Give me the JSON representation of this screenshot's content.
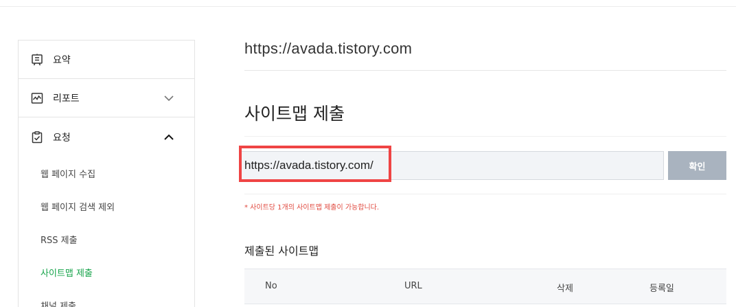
{
  "sidebar": {
    "items": [
      {
        "label": "요약",
        "icon": "summary-icon"
      },
      {
        "label": "리포트",
        "icon": "report-icon",
        "chevron": "chevron-down"
      },
      {
        "label": "요청",
        "icon": "request-icon",
        "chevron": "chevron-up"
      }
    ],
    "sub_items": [
      {
        "label": "웹 페이지 수집",
        "active": false
      },
      {
        "label": "웹 페이지 검색 제외",
        "active": false
      },
      {
        "label": "RSS 제출",
        "active": false
      },
      {
        "label": "사이트맵 제출",
        "active": true
      },
      {
        "label": "채널 제출",
        "active": false
      }
    ]
  },
  "main": {
    "site_url": "https://avada.tistory.com",
    "heading": "사이트맵 제출",
    "sitemap_input_value": "https://avada.tistory.com/",
    "confirm_label": "확인",
    "notice": "* 사이트당 1개의 사이트맵 제출이 가능합니다.",
    "submitted_heading": "제출된 사이트맵",
    "table_headers": [
      "No",
      "URL",
      "삭제",
      "등록일"
    ]
  },
  "colors": {
    "active_green": "#16a34a",
    "highlight_red": "#ef4444",
    "button_gray": "#a9b3bf",
    "notice_red": "#e0483e"
  }
}
